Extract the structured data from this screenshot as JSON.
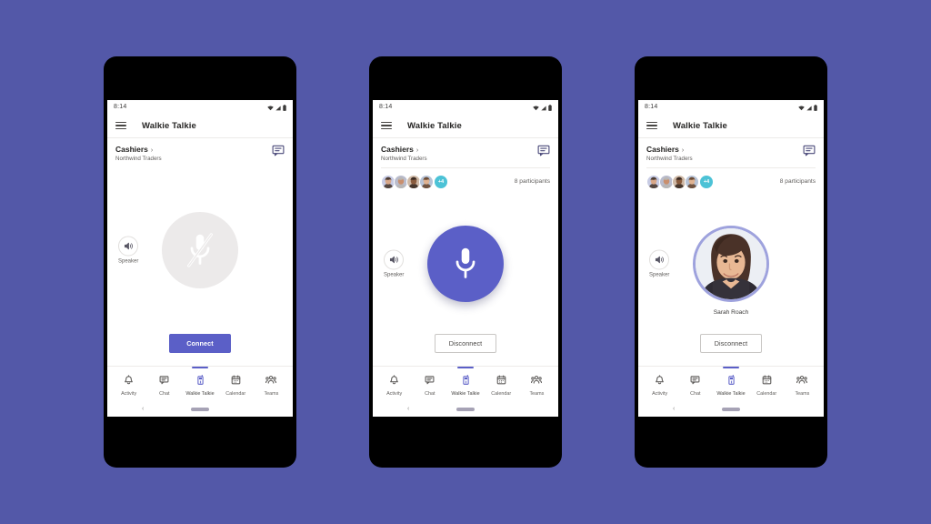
{
  "background_color": "#5358a8",
  "accent_color": "#5b5fc7",
  "badge_color": "#4cc2d6",
  "status_bar": {
    "time": "8:14",
    "icons": [
      "wifi-icon",
      "cellular-signal-icon",
      "battery-icon"
    ]
  },
  "app_bar": {
    "menu_icon": "hamburger-menu-icon",
    "title": "Walkie Talkie"
  },
  "channel": {
    "name": "Cashiers",
    "chevron": "›",
    "team": "Northwind Traders",
    "chat_icon": "chat-bubble-icon"
  },
  "participants": {
    "overflow_badge": "+4",
    "count_label": "8 participants"
  },
  "speaker": {
    "label": "Speaker",
    "icon": "speaker-volume-icon"
  },
  "tabs": [
    {
      "label": "Activity",
      "icon": "bell-icon",
      "active": false
    },
    {
      "label": "Chat",
      "icon": "chat-icon",
      "active": false
    },
    {
      "label": "Walkie Talkie",
      "icon": "walkie-talkie-icon",
      "active": true
    },
    {
      "label": "Calendar",
      "icon": "calendar-icon",
      "active": false
    },
    {
      "label": "Teams",
      "icon": "teams-people-icon",
      "active": false
    }
  ],
  "android_nav": {
    "back_glyph": "‹",
    "home_pill": "home-indicator-pill"
  },
  "phones": [
    {
      "state": "disconnected",
      "ptt_icon": "microphone-muted-icon",
      "ptt_style": "idle",
      "show_participants": false,
      "talker_name": "",
      "action_label": "Connect",
      "action_style": "primary"
    },
    {
      "state": "connected-idle",
      "ptt_icon": "microphone-icon",
      "ptt_style": "active",
      "show_participants": true,
      "talker_name": "",
      "action_label": "Disconnect",
      "action_style": "ghost"
    },
    {
      "state": "someone-talking",
      "ptt_icon": "speaker-photo",
      "ptt_style": "photo",
      "show_participants": true,
      "talker_name": "Sarah Roach",
      "action_label": "Disconnect",
      "action_style": "ghost"
    }
  ]
}
